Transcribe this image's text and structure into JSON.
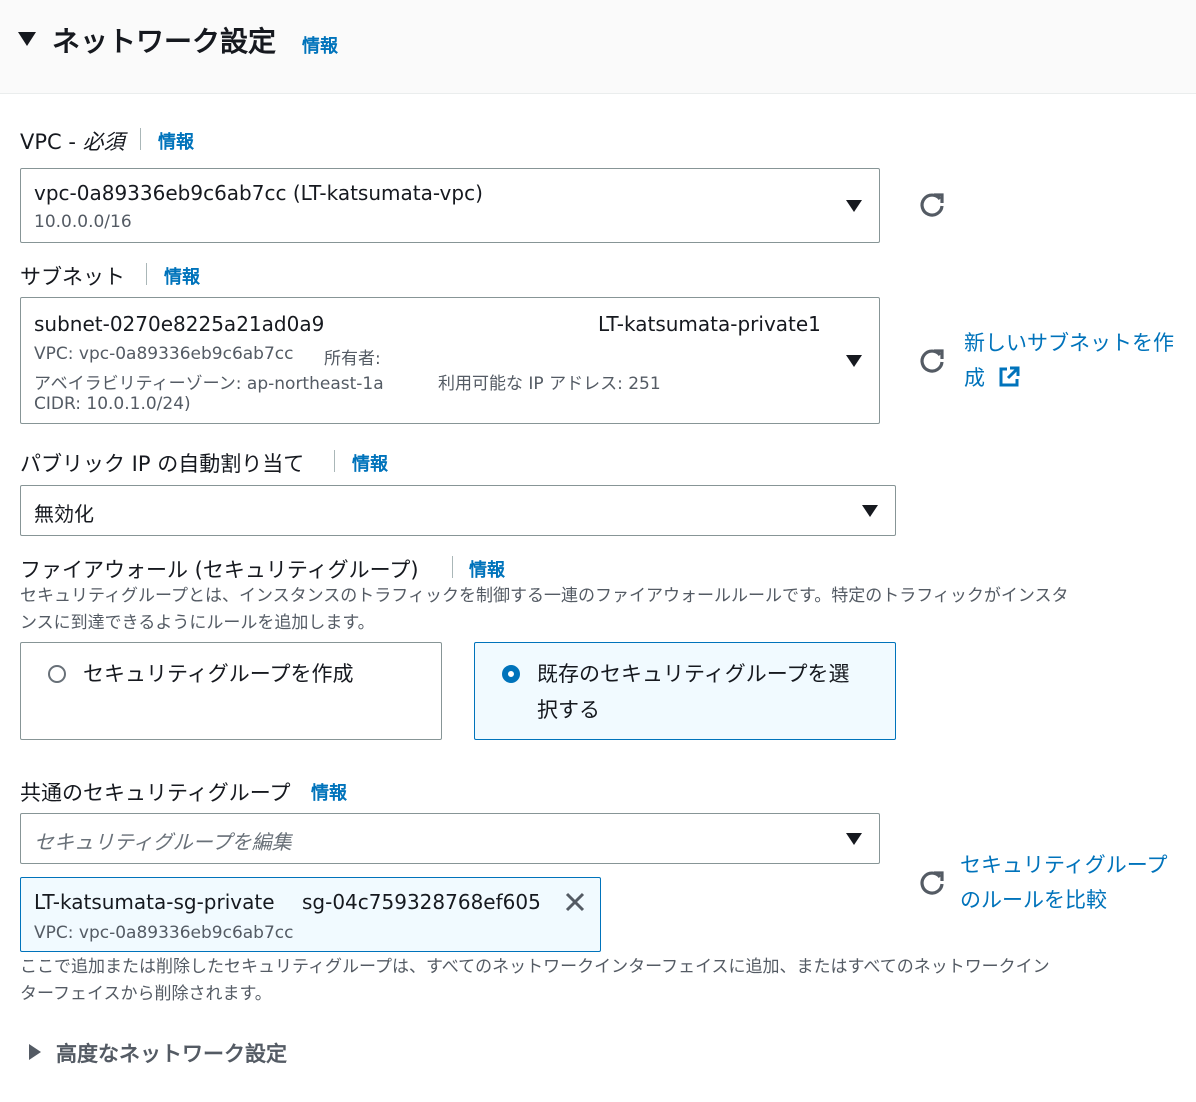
{
  "section": {
    "title": "ネットワーク設定",
    "info": "情報"
  },
  "vpc": {
    "label": "VPC - ",
    "label_required": "必須",
    "info": "情報",
    "value": "vpc-0a89336eb9c6ab7cc (LT-katsumata-vpc)",
    "cidr": "10.0.0.0/16"
  },
  "subnet": {
    "label": "サブネット",
    "info": "情報",
    "value": "subnet-0270e8225a21ad0a9",
    "name": "LT-katsumata-private1",
    "vpc_line": "VPC: vpc-0a89336eb9c6ab7cc",
    "owner_line": "所有者:",
    "az_line": "アベイラビリティーゾーン: ap-northeast-1a",
    "ip_line": "利用可能な IP アドレス: 251",
    "cidr_line": "CIDR: 10.0.1.0/24)",
    "create_link_line1": "新しいサブネットを作",
    "create_link_line2": "成"
  },
  "public_ip": {
    "label": "パブリック IP の自動割り当て",
    "info": "情報",
    "value": "無効化"
  },
  "firewall": {
    "label": "ファイアウォール (セキュリティグループ)",
    "info": "情報",
    "desc_line1": "セキュリティグループとは、インスタンスのトラフィックを制御する一連のファイアウォールルールです。特定のトラフィックがインスタ",
    "desc_line2": "ンスに到達できるようにルールを追加します。",
    "option_create": "セキュリティグループを作成",
    "option_existing_line1": "既存のセキュリティグループを選",
    "option_existing_line2": "択する",
    "selected": "existing"
  },
  "common_sg": {
    "label": "共通のセキュリティグループ",
    "info": "情報",
    "placeholder": "セキュリティグループを編集",
    "token_name": "LT-katsumata-sg-private",
    "token_id": "sg-04c759328768ef605",
    "token_vpc": "VPC: vpc-0a89336eb9c6ab7cc",
    "compare_link_line1": "セキュリティグループ",
    "compare_link_line2": "のルールを比較",
    "note_line1": "ここで追加または削除したセキュリティグループは、すべてのネットワークインターフェイスに追加、またはすべてのネットワークイン",
    "note_line2": "ターフェイスから削除されます。"
  },
  "advanced": {
    "label": "高度なネットワーク設定"
  },
  "colors": {
    "link": "#0073bb",
    "selected_bg": "#f1faff"
  },
  "icons": [
    "caret-down-icon",
    "refresh-icon",
    "external-link-icon",
    "close-icon",
    "caret-right-icon"
  ]
}
